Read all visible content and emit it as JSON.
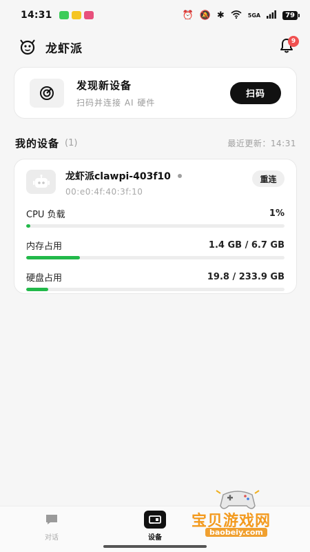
{
  "status_bar": {
    "time": "14:31",
    "network_label": "5GA",
    "battery": "79",
    "app_icon_colors": [
      "#3dcc5a",
      "#f5c522",
      "#e8507c"
    ]
  },
  "header": {
    "title": "龙虾派",
    "notification_count": "9"
  },
  "discover": {
    "title": "发现新设备",
    "subtitle": "扫码并连接 AI 硬件",
    "button": "扫码"
  },
  "section": {
    "title": "我的设备",
    "count": "(1)",
    "last_update": "最近更新：14:31"
  },
  "device": {
    "name": "龙虾派clawpi-403f10",
    "mac": "00:e0:4f:40:3f:10",
    "reconnect": "重连",
    "status_color": "#a0a0a0",
    "metrics": [
      {
        "label": "CPU 负载",
        "value": "1%",
        "fraction": 0.01
      },
      {
        "label": "内存占用",
        "value": "1.4 GB / 6.7 GB",
        "fraction": 0.209
      },
      {
        "label": "硬盘占用",
        "value": "19.8 / 233.9 GB",
        "fraction": 0.085
      }
    ]
  },
  "nav": {
    "items": [
      {
        "label": "对话",
        "icon": "chat-icon",
        "active": false
      },
      {
        "label": "设备",
        "icon": "device-icon",
        "active": true
      }
    ]
  },
  "watermark": {
    "text": "宝贝游戏网",
    "url": "baobeiy.com"
  },
  "colors": {
    "accent": "#111111",
    "progress": "#22b94a",
    "badge": "#f05050"
  }
}
